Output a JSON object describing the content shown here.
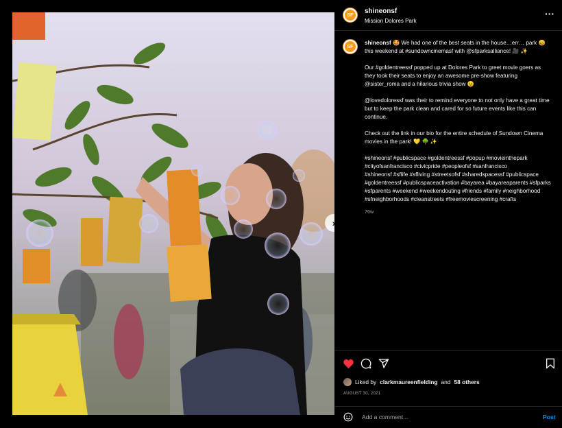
{
  "post": {
    "username": "shineonsf",
    "location": "Mission Dolores Park",
    "avatar_text": "SF",
    "caption_paragraphs": [
      "🤩 We had one of the best seats in the house…err… park 😄 this weekend at #sundowncinemasf with @sfparksalliance! 🎥 ✨",
      "Our #goldentreessf popped up at Dolores Park to greet movie goers as they took their seats to enjoy an awesome pre-show featuring @sister_roma and a hilarious trivia show 😉",
      "@lovedoloressf was their to remind everyone to not only have a great time but to keep the park clean and cared for so future events like this can continue.",
      "Check out the link in our bio for the entire schedule of Sundown Cinema movies in the park! 💛 🌳 ✨",
      "#shineonsf #publicspace #goldentreessf #popup #movieinthepark #cityofsanfrancisco #civicpride #peopleofsf #sanfrancisco\n#shineonsf #sflife #sfliving #streetsofsf #sharedspacessf #publicspace #goldentreessf #publicspaceactivation #bayarea #bayareaparents #sfparks #sfparents #weekend #weekendouting #friends #family #neighborhood #sfneighborhoods #cleanstreets #freemoviescreening #crafts"
    ],
    "time_ago": "76w",
    "liked_by_prefix": "Liked by",
    "liked_by_user": "clarkmaureenfielding",
    "liked_by_and": "and",
    "liked_by_others": "58 others",
    "date": "AUGUST 30, 2021"
  },
  "photo": {
    "carousel_count": 9,
    "carousel_active": 0,
    "next_icon": "chevron-right-icon"
  },
  "header": {
    "more_icon": "more-horizontal-icon",
    "more_glyph": "···"
  },
  "actions": {
    "icons": [
      "heart-filled-icon",
      "comment-icon",
      "share-icon",
      "bookmark-icon"
    ],
    "like_color": "#ff3040"
  },
  "comment": {
    "placeholder": "Add a comment...",
    "post_label": "Post",
    "emoji_icon": "emoji-icon"
  },
  "colors": {
    "background": "#000000",
    "text": "#f5f5f5",
    "muted": "#a8a8a8",
    "link": "#0095f6",
    "brand": "#f39a1f"
  }
}
